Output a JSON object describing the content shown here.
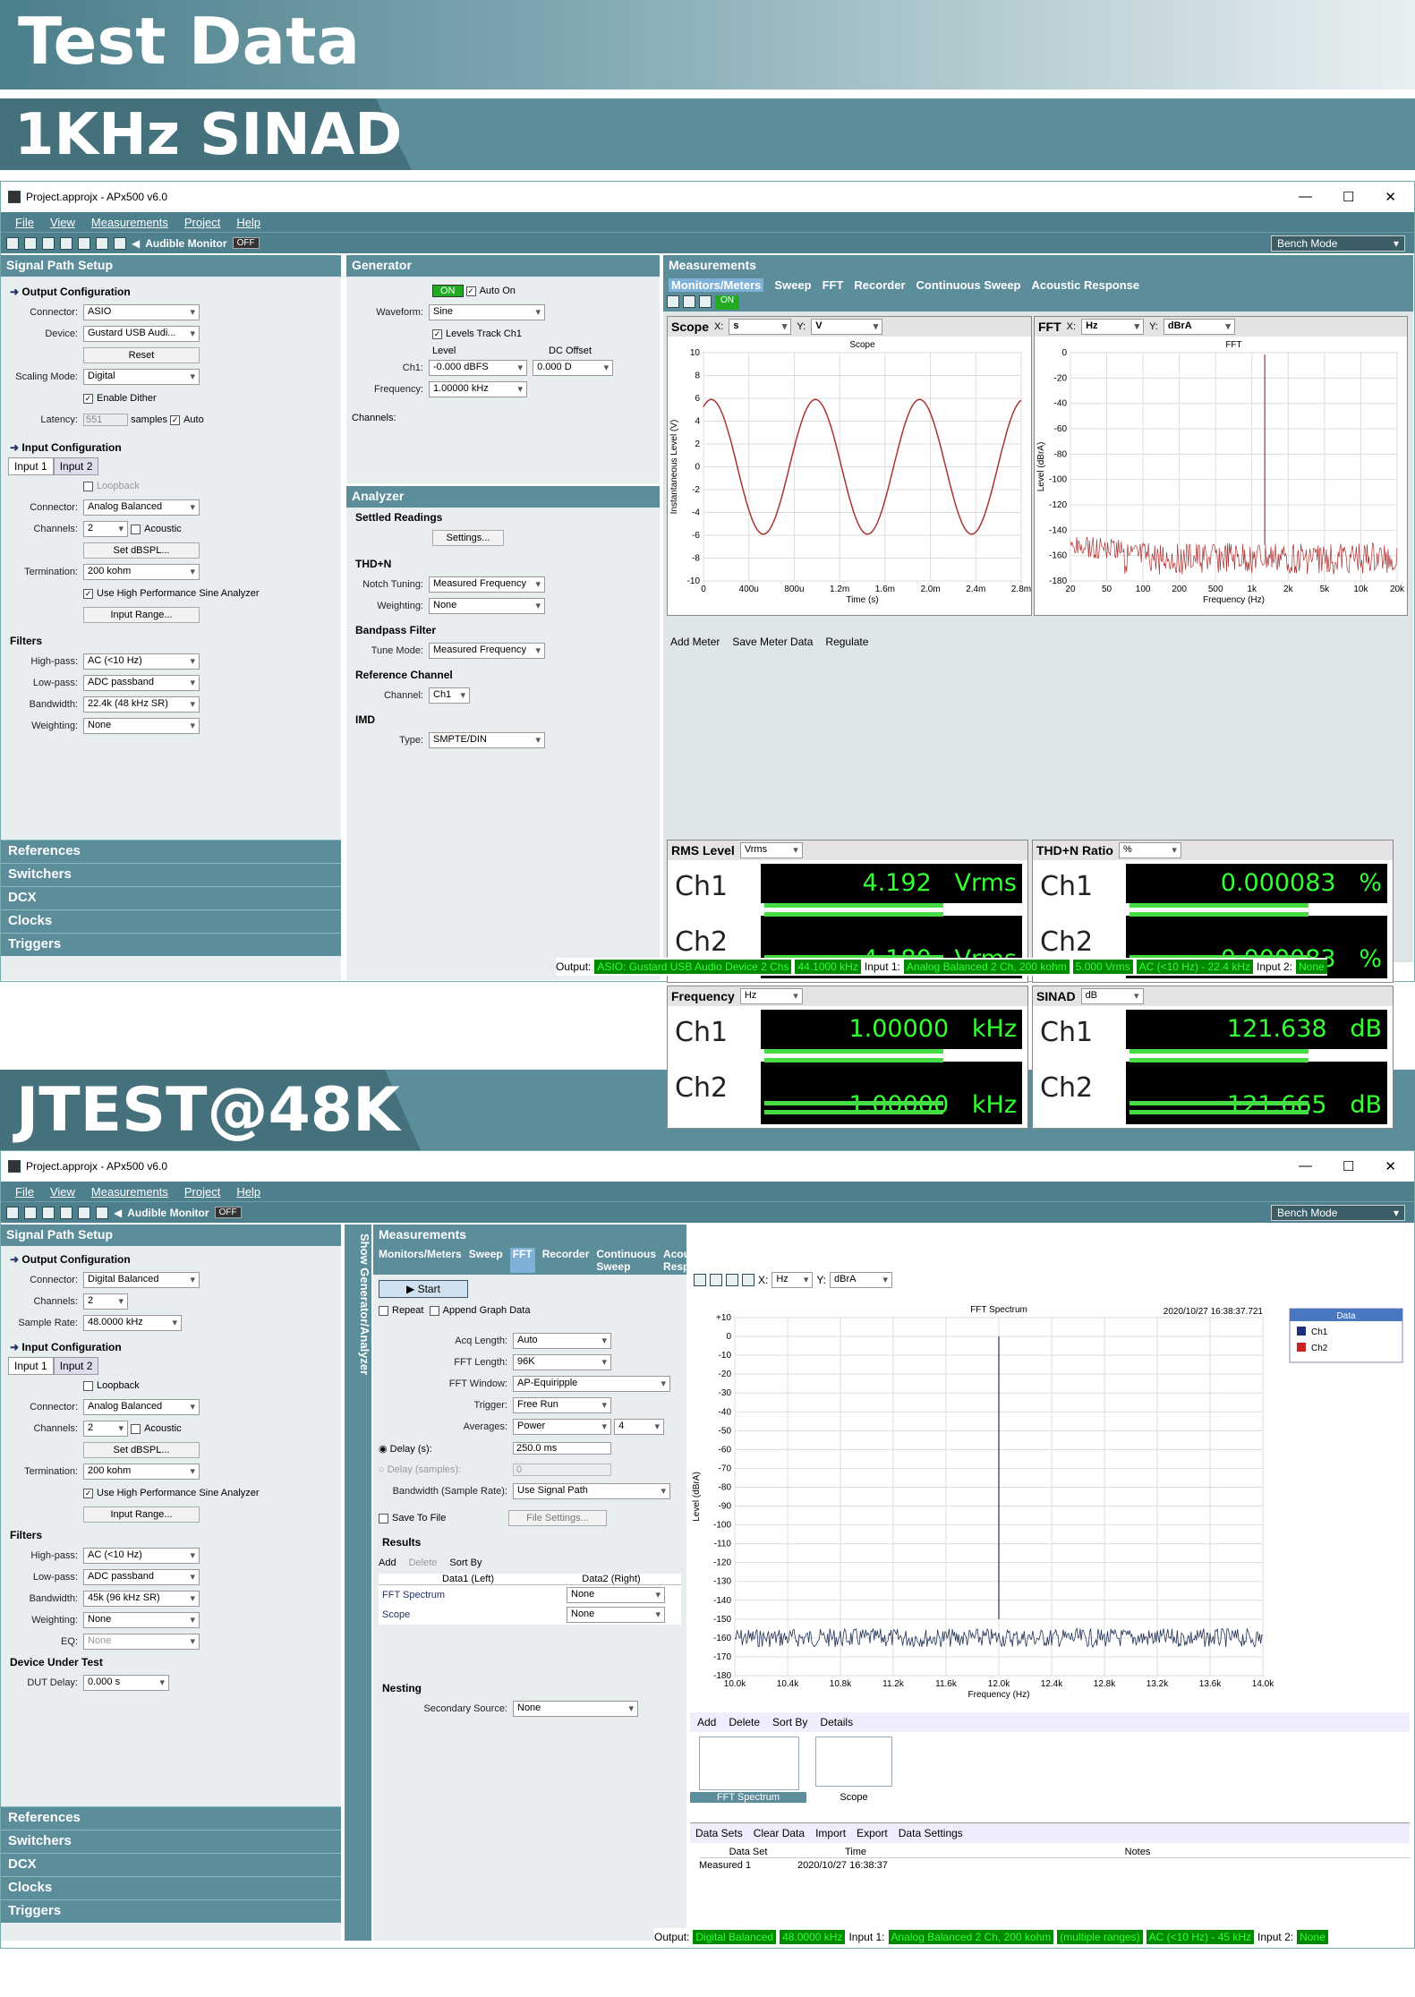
{
  "banners": {
    "test_data": "Test Data",
    "sinad": "1KHz SINAD",
    "jtest": "JTEST@48K"
  },
  "win1": {
    "title": "Project.approjx - APx500 v6.0",
    "menu": [
      "File",
      "View",
      "Measurements",
      "Project",
      "Help"
    ],
    "audible": "Audible Monitor",
    "off": "OFF",
    "bench": "Bench Mode",
    "sps": {
      "head": "Signal Path Setup",
      "out_cfg": "Output Configuration",
      "connector_l": "Connector:",
      "connector": "ASIO",
      "device_l": "Device:",
      "device": "Gustard USB Audi...",
      "reset": "Reset",
      "scaling_l": "Scaling Mode:",
      "scaling": "Digital",
      "dither": "Enable Dither",
      "latency_l": "Latency:",
      "latency": "551",
      "samples": "samples",
      "auto": "Auto",
      "in_cfg": "Input Configuration",
      "tab1": "Input 1",
      "tab2": "Input 2",
      "loopback": "Loopback",
      "in_conn": "Analog Balanced",
      "channels_l": "Channels:",
      "channels": "2",
      "acoustic": "Acoustic",
      "set_dbspl": "Set dBSPL...",
      "term_l": "Termination:",
      "term": "200 kohm",
      "hp_sine": "Use High Performance Sine Analyzer",
      "range": "Input Range...",
      "filters": "Filters",
      "hp_l": "High-pass:",
      "hp": "AC (<10 Hz)",
      "lp_l": "Low-pass:",
      "lp": "ADC passband",
      "bw_l": "Bandwidth:",
      "bw": "22.4k (48 kHz SR)",
      "wt_l": "Weighting:",
      "wt": "None"
    },
    "side": [
      "References",
      "Switchers",
      "DCX",
      "Clocks",
      "Triggers"
    ],
    "gen": {
      "head": "Generator",
      "on": "ON",
      "auto_on": "Auto On",
      "wave_l": "Waveform:",
      "wave": "Sine",
      "track": "Levels Track Ch1",
      "level_h": "Level",
      "dc_h": "DC Offset",
      "ch1_l": "Ch1:",
      "level": "-0.000 dBFS",
      "dc": "0.000 D",
      "freq_l": "Frequency:",
      "freq": "1.00000 kHz",
      "chans_l": "Channels:"
    },
    "ana": {
      "head": "Analyzer",
      "settled": "Settled Readings",
      "settings": "Settings...",
      "thdn": "THD+N",
      "notch_l": "Notch Tuning:",
      "notch": "Measured Frequency",
      "wt_l": "Weighting:",
      "wt": "None",
      "bpf": "Bandpass Filter",
      "tune_l": "Tune Mode:",
      "tune": "Measured Frequency",
      "ref": "Reference Channel",
      "chan_l": "Channel:",
      "chan": "Ch1",
      "imd": "IMD",
      "type_l": "Type:",
      "type": "SMPTE/DIN"
    },
    "meas": {
      "head": "Measurements",
      "tabs": [
        "Monitors/Meters",
        "Sweep",
        "FFT",
        "Recorder",
        "Continuous Sweep",
        "Acoustic Response"
      ],
      "scope": {
        "name": "Scope",
        "x": "s",
        "y": "V",
        "title": "Scope",
        "xlabel": "Time (s)",
        "ylabel": "Instantaneous Level (V)",
        "yticks": [
          "10",
          "8",
          "6",
          "4",
          "2",
          "0",
          "-2",
          "-4",
          "-6",
          "-8",
          "-10"
        ],
        "xticks": [
          "0",
          "400u",
          "800u",
          "1.2m",
          "1.6m",
          "2.0m",
          "2.4m",
          "2.8m"
        ]
      },
      "fft": {
        "name": "FFT",
        "x": "Hz",
        "y": "dBrA",
        "title": "FFT",
        "xlabel": "Frequency (Hz)",
        "ylabel": "Level (dBrA)",
        "yticks": [
          "0",
          "-20",
          "-40",
          "-60",
          "-80",
          "-100",
          "-120",
          "-140",
          "-160",
          "-180"
        ],
        "xticks": [
          "20",
          "50",
          "100",
          "200",
          "500",
          "1k",
          "2k",
          "5k",
          "10k",
          "20k"
        ]
      },
      "tools": {
        "add": "Add Meter",
        "save": "Save Meter Data",
        "reg": "Regulate"
      },
      "meters": [
        {
          "name": "RMS Level",
          "unit_sel": "Vrms",
          "ch1": "4.192",
          "ch2": "4.180",
          "unit": "Vrms"
        },
        {
          "name": "THD+N Ratio",
          "unit_sel": "%",
          "ch1": "0.000083",
          "ch2": "0.000083",
          "unit": "%"
        },
        {
          "name": "Frequency",
          "unit_sel": "Hz",
          "ch1": "1.00000",
          "ch2": "1.00000",
          "unit": "kHz"
        },
        {
          "name": "SINAD",
          "unit_sel": "dB",
          "ch1": "121.638",
          "ch2": "121.665",
          "unit": "dB"
        }
      ],
      "ch1": "Ch1",
      "ch2": "Ch2"
    },
    "status": {
      "output_l": "Output:",
      "out": "ASIO: Gustard USB Audio Device 2 Chs",
      "sr": "44.1000 kHz",
      "in1_l": "Input 1:",
      "in1": "Analog Balanced 2 Ch, 200 kohm",
      "lvl": "5.000 Vrms",
      "filt": "AC (<10 Hz) - 22.4 kHz",
      "in2_l": "Input 2:",
      "in2": "None"
    }
  },
  "win2": {
    "title": "Project.approjx - APx500 v6.0",
    "sps": {
      "connector": "Digital Balanced",
      "channels": "2",
      "sr_l": "Sample Rate:",
      "sr": "48.0000 kHz",
      "hp": "AC (<10 Hz)",
      "lp": "ADC passband",
      "bw": "45k (96 kHz SR)",
      "wt": "None",
      "eq_l": "EQ:",
      "eq": "None",
      "dut": "Device Under Test",
      "dut_l": "DUT Delay:",
      "dut_v": "0.000 s"
    },
    "show_gen": "Show Generator/Analyzer",
    "fftpanel": {
      "start": "Start",
      "repeat": "Repeat",
      "append": "Append Graph Data",
      "acq_l": "Acq Length:",
      "acq": "Auto",
      "len_l": "FFT Length:",
      "len": "96K",
      "win_l": "FFT Window:",
      "win": "AP-Equiripple",
      "trig_l": "Trigger:",
      "trig": "Free Run",
      "avg_l": "Averages:",
      "avg": "Power",
      "avg_n": "4",
      "delay_l": "Delay (s):",
      "delay": "250.0 ms",
      "delays_l": "Delay (samples):",
      "delays": "0",
      "bwsr_l": "Bandwidth (Sample Rate):",
      "bwsr": "Use Signal Path",
      "save": "Save To File",
      "fset": "File Settings...",
      "results": "Results",
      "add": "Add",
      "del": "Delete",
      "sort": "Sort By",
      "col1": "Data1 (Left)",
      "col2": "Data2 (Right)",
      "r1": "FFT Spectrum",
      "r2": "Scope",
      "none": "None",
      "nesting": "Nesting",
      "sec_l": "Secondary Source:"
    },
    "graph": {
      "title": "FFT Spectrum",
      "stamp": "2020/10/27 16:38:37.721",
      "x": "Hz",
      "y": "dBrA",
      "xlabel": "Frequency (Hz)",
      "ylabel": "Level (dBrA)",
      "yticks": [
        "+10",
        "0",
        "-10",
        "-20",
        "-30",
        "-40",
        "-50",
        "-60",
        "-70",
        "-80",
        "-90",
        "-100",
        "-110",
        "-120",
        "-130",
        "-140",
        "-150",
        "-160",
        "-170",
        "-180"
      ],
      "xticks": [
        "10.0k",
        "10.4k",
        "10.8k",
        "11.2k",
        "11.6k",
        "12.0k",
        "12.4k",
        "12.8k",
        "13.2k",
        "13.6k",
        "14.0k"
      ],
      "legend": "Data",
      "l1": "Ch1",
      "l2": "Ch2"
    },
    "thumbs": {
      "add": "Add",
      "del": "Delete",
      "sort": "Sort By",
      "details": "Details",
      "t1": "FFT Spectrum",
      "t2": "Scope"
    },
    "datasets": {
      "label": "Data Sets",
      "clear": "Clear Data",
      "import": "Import",
      "export": "Export",
      "dset": "Data Settings",
      "h1": "Data Set",
      "h2": "Time",
      "h3": "Notes",
      "name": "Measured 1",
      "time": "2020/10/27 16:38:37"
    },
    "status": {
      "out": "Digital Balanced",
      "sr": "48.0000 kHz",
      "in1": "Analog Balanced 2 Ch, 200 kohm",
      "rng": "(multiple ranges)",
      "filt": "AC (<10 Hz) - 45 kHz",
      "in2": "None"
    }
  }
}
